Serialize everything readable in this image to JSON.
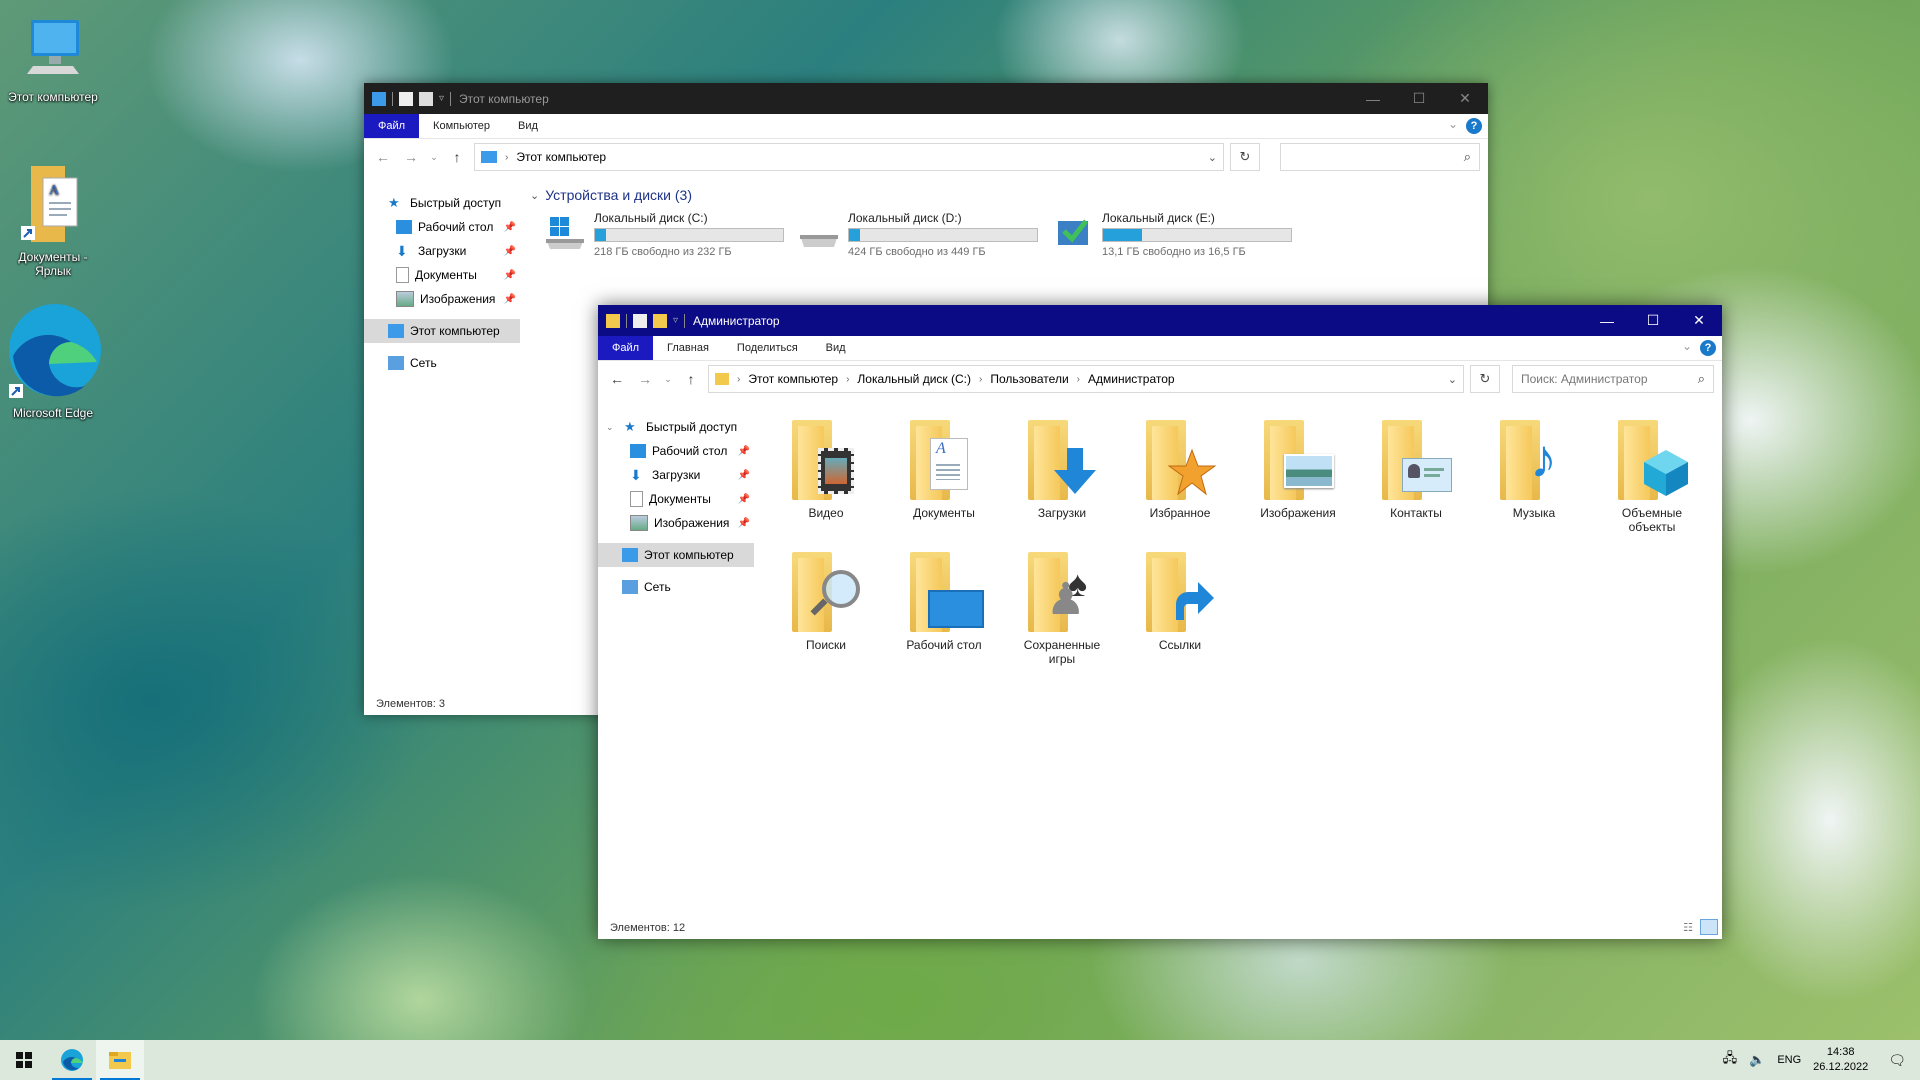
{
  "desktop": {
    "icons": [
      {
        "label": "Этот компьютер"
      },
      {
        "label": "Документы - Ярлык"
      },
      {
        "label": "Microsoft Edge"
      }
    ]
  },
  "back_window": {
    "title": "Этот компьютер",
    "ribbon": {
      "file": "Файл",
      "tabs": [
        "Компьютер",
        "Вид"
      ]
    },
    "address": "Этот компьютер",
    "nav": {
      "quick_access": "Быстрый доступ",
      "pinned": [
        "Рабочий стол",
        "Загрузки",
        "Документы",
        "Изображения"
      ],
      "this_pc": "Этот компьютер",
      "network": "Сеть"
    },
    "section_title": "Устройства и диски (3)",
    "drives": [
      {
        "name": "Локальный диск (C:)",
        "free": "218 ГБ свободно из 232 ГБ",
        "used_fraction": 0.06
      },
      {
        "name": "Локальный диск (D:)",
        "free": "424 ГБ свободно из 449 ГБ",
        "used_fraction": 0.06
      },
      {
        "name": "Локальный диск (E:)",
        "free": "13,1 ГБ свободно из 16,5 ГБ",
        "used_fraction": 0.21
      }
    ],
    "status": "Элементов: 3"
  },
  "front_window": {
    "title": "Администратор",
    "ribbon": {
      "file": "Файл",
      "tabs": [
        "Главная",
        "Поделиться",
        "Вид"
      ]
    },
    "breadcrumbs": [
      "Этот компьютер",
      "Локальный диск (C:)",
      "Пользователи",
      "Администратор"
    ],
    "search_placeholder": "Поиск: Администратор",
    "nav": {
      "quick_access": "Быстрый доступ",
      "pinned": [
        "Рабочий стол",
        "Загрузки",
        "Документы",
        "Изображения"
      ],
      "this_pc": "Этот компьютер",
      "network": "Сеть"
    },
    "folders": [
      {
        "label": "Видео",
        "icon": "video-folder-icon"
      },
      {
        "label": "Документы",
        "icon": "documents-folder-icon"
      },
      {
        "label": "Загрузки",
        "icon": "downloads-folder-icon"
      },
      {
        "label": "Избранное",
        "icon": "favorites-folder-icon"
      },
      {
        "label": "Изображения",
        "icon": "pictures-folder-icon"
      },
      {
        "label": "Контакты",
        "icon": "contacts-folder-icon"
      },
      {
        "label": "Музыка",
        "icon": "music-folder-icon"
      },
      {
        "label": "Объемные объекты",
        "icon": "3d-objects-folder-icon"
      },
      {
        "label": "Поиски",
        "icon": "searches-folder-icon"
      },
      {
        "label": "Рабочий стол",
        "icon": "desktop-folder-icon"
      },
      {
        "label": "Сохраненные игры",
        "icon": "saved-games-folder-icon"
      },
      {
        "label": "Ссылки",
        "icon": "links-folder-icon"
      }
    ],
    "status": "Элементов: 12"
  },
  "taskbar": {
    "language": "ENG",
    "time": "14:38",
    "date": "26.12.2022"
  },
  "colors": {
    "front_titlebar": "#0b0b85",
    "back_titlebar": "#1f1f1f",
    "file_tab": "#1979ca",
    "drive_fill": "#26a0da"
  }
}
